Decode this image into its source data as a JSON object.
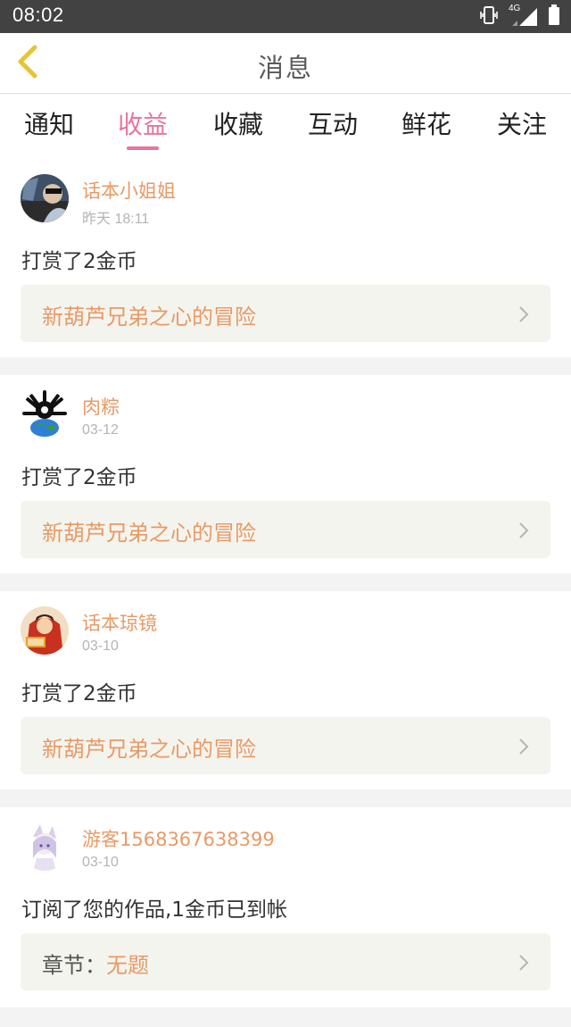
{
  "status": {
    "time": "08:02",
    "network": "4G"
  },
  "header": {
    "title": "消息",
    "back_icon": "chevron-left-icon",
    "accent": "#e8c33a"
  },
  "tabs": [
    {
      "label": "通知"
    },
    {
      "label": "收益",
      "active": true
    },
    {
      "label": "收藏"
    },
    {
      "label": "互动"
    },
    {
      "label": "鲜花"
    },
    {
      "label": "关注"
    }
  ],
  "colors": {
    "active_tab": "#e8749f",
    "name": "#e89a66",
    "link_bg": "#f4f4ee"
  },
  "feed": [
    {
      "user": "话本小姐姐",
      "time": "昨天 18:11",
      "action": "打赏了2金币",
      "link": "新葫芦兄弟之心的冒险"
    },
    {
      "user": "肉粽",
      "time": "03-12",
      "action": "打赏了2金币",
      "link": "新葫芦兄弟之心的冒险"
    },
    {
      "user": "话本琼镜",
      "time": "03-10",
      "action": "打赏了2金币",
      "link": "新葫芦兄弟之心的冒险"
    },
    {
      "user": "游客1568367638399",
      "time": "03-10",
      "action": "订阅了您的作品,1金币已到帐",
      "link_label": "章节：",
      "link": "无题"
    }
  ]
}
